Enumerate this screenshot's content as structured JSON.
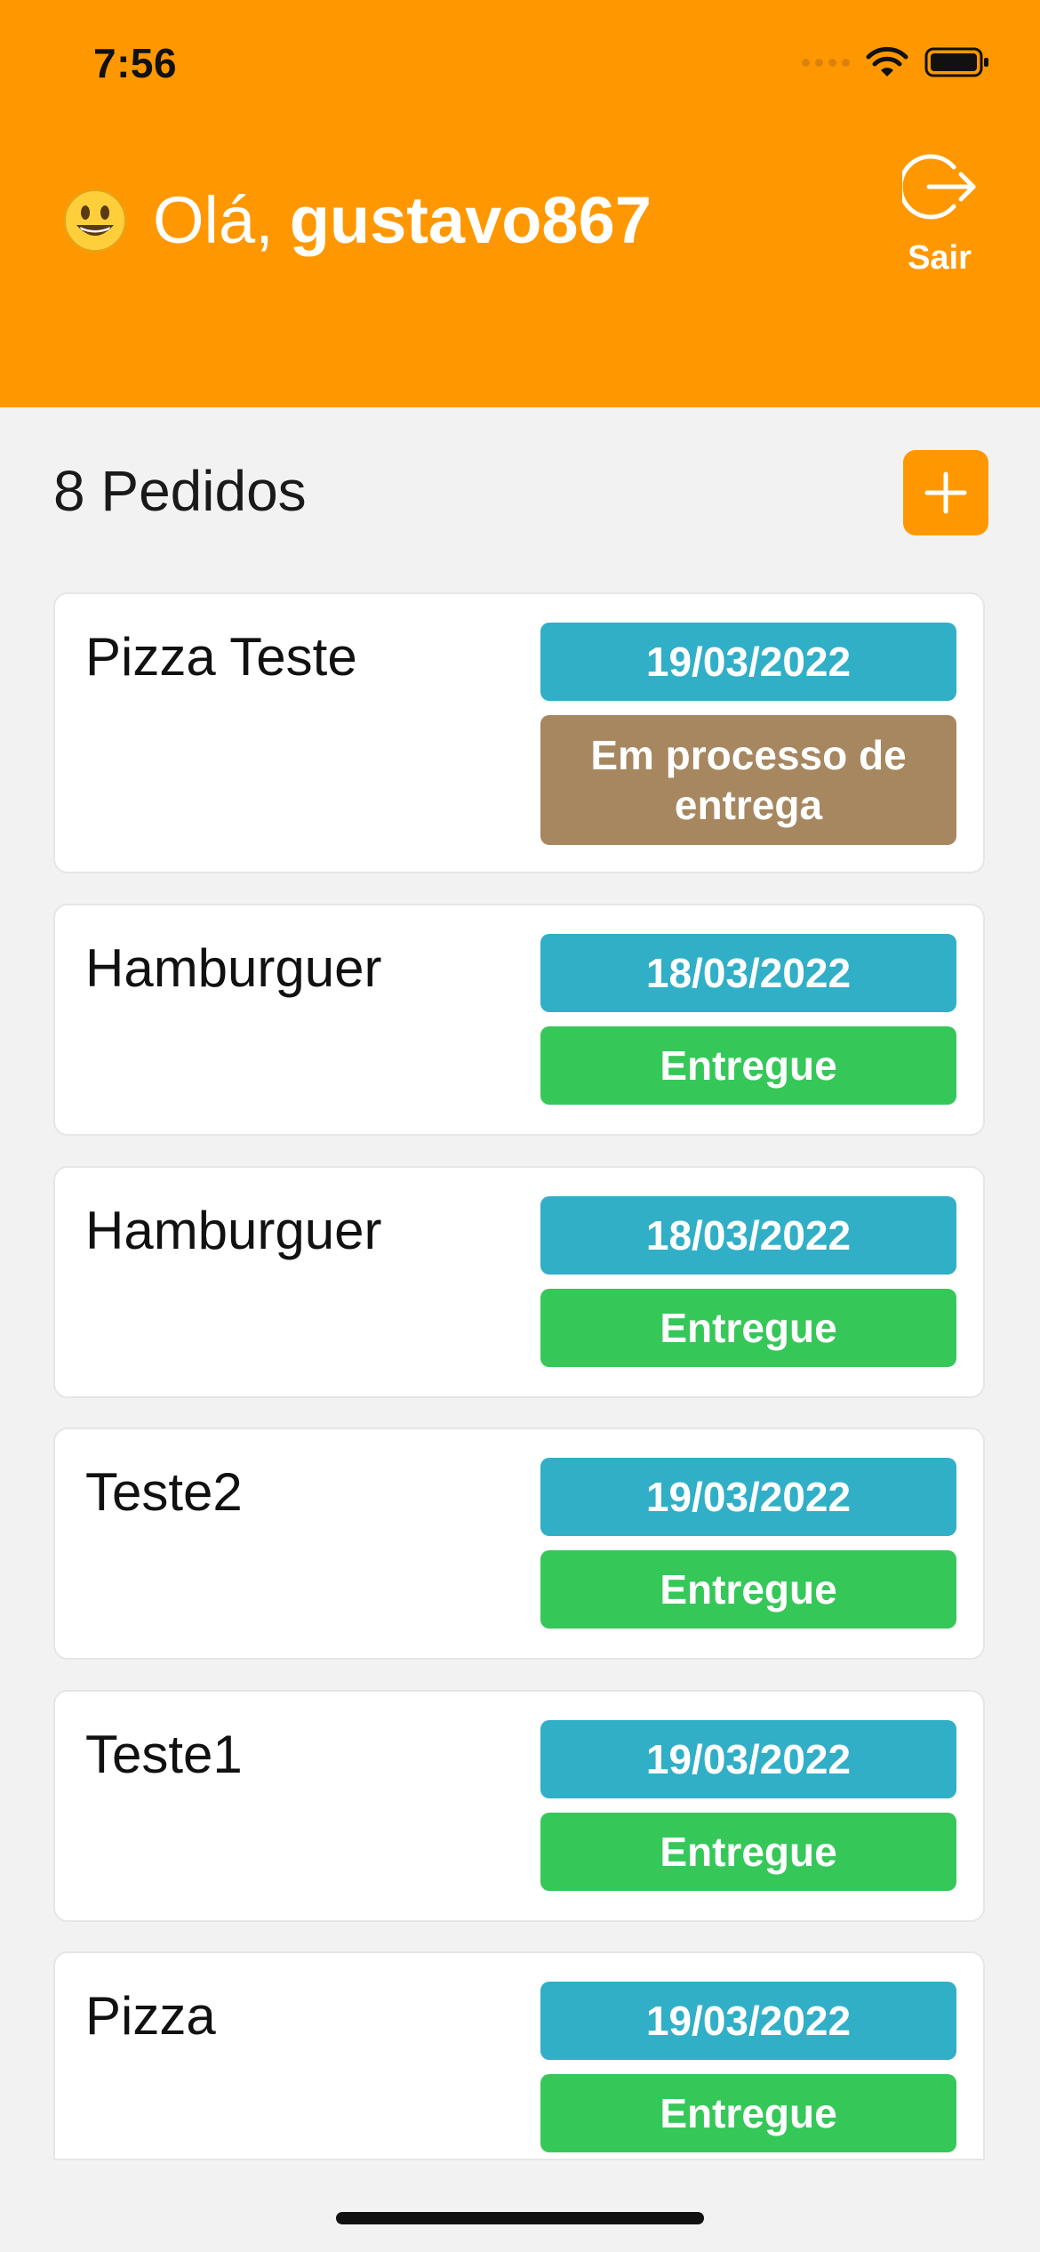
{
  "status_bar": {
    "time": "7:56"
  },
  "header": {
    "greeting_prefix": "Olá,",
    "username": "gustavo867",
    "emoji_icon": "smiley-emoji",
    "logout_label": "Sair"
  },
  "orders": {
    "count_label": "8 Pedidos",
    "add_icon": "plus-icon",
    "items": [
      {
        "name": "Pizza Teste",
        "date": "19/03/2022",
        "status": "Em processo de entrega",
        "status_color": "#a68760"
      },
      {
        "name": "Hamburguer",
        "date": "18/03/2022",
        "status": "Entregue",
        "status_color": "#36c759"
      },
      {
        "name": "Hamburguer",
        "date": "18/03/2022",
        "status": "Entregue",
        "status_color": "#36c759"
      },
      {
        "name": "Teste2",
        "date": "19/03/2022",
        "status": "Entregue",
        "status_color": "#36c759"
      },
      {
        "name": "Teste1",
        "date": "19/03/2022",
        "status": "Entregue",
        "status_color": "#36c759"
      },
      {
        "name": "Pizza",
        "date": "19/03/2022",
        "status": "Entregue",
        "status_color": "#36c759"
      }
    ]
  },
  "colors": {
    "brand_orange": "#ff9800",
    "date_blue": "#30afc7",
    "delivered_green": "#36c759",
    "processing_brown": "#a68760"
  }
}
